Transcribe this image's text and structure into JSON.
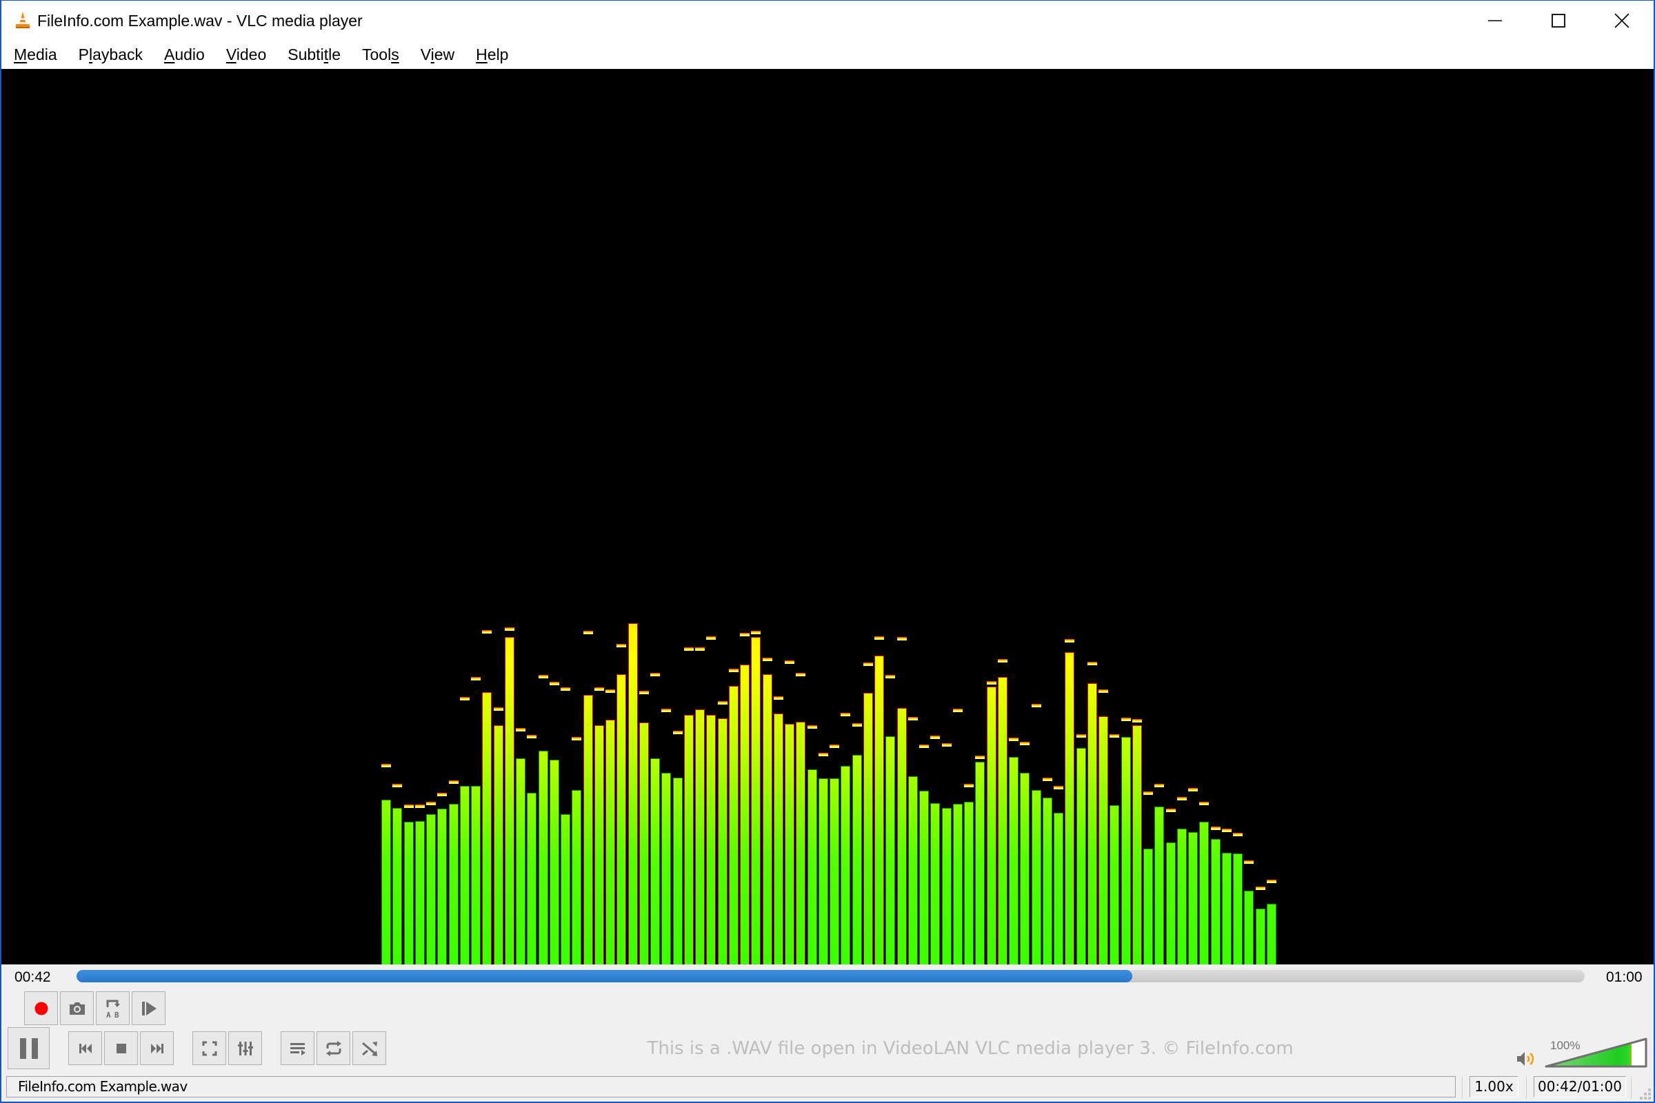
{
  "window": {
    "title": "FileInfo.com Example.wav - VLC media player",
    "controls": [
      "minimize",
      "maximize",
      "close"
    ]
  },
  "menu": [
    {
      "label": "Media",
      "accel_index": 0
    },
    {
      "label": "Playback",
      "accel_index": 1
    },
    {
      "label": "Audio",
      "accel_index": 0
    },
    {
      "label": "Video",
      "accel_index": 0
    },
    {
      "label": "Subtitle",
      "accel_index": 5
    },
    {
      "label": "Tools",
      "accel_index": 4
    },
    {
      "label": "View",
      "accel_index": 1
    },
    {
      "label": "Help",
      "accel_index": 0
    }
  ],
  "visualization": {
    "type": "spectrum-analyzer",
    "bar_count": 80,
    "levels_percent": [
      18.4,
      17.5,
      15.9,
      16.0,
      16.8,
      17.4,
      17.9,
      19.9,
      19.9,
      30.4,
      26.7,
      36.6,
      23.0,
      19.2,
      23.9,
      22.9,
      16.8,
      19.5,
      30.1,
      26.7,
      27.3,
      32.4,
      38.1,
      27.0,
      23.0,
      21.4,
      20.9,
      27.9,
      28.5,
      27.9,
      27.5,
      31.1,
      33.5,
      36.6,
      32.4,
      28.0,
      26.9,
      27.1,
      21.8,
      20.8,
      20.8,
      22.2,
      23.4,
      30.3,
      34.5,
      25.5,
      28.6,
      21.0,
      19.4,
      18.0,
      17.5,
      17.9,
      18.2,
      22.6,
      31.0,
      32.1,
      23.2,
      21.4,
      19.5,
      18.6,
      16.9,
      34.9,
      24.2,
      31.4,
      27.7,
      17.8,
      25.4,
      26.7,
      12.9,
      17.6,
      13.6,
      15.2,
      14.8,
      15.9,
      14.0,
      12.5,
      12.4,
      8.2,
      6.2,
      6.8
    ],
    "peaks_percent": [
      22.2,
      19.9,
      17.6,
      17.6,
      17.9,
      18.9,
      20.3,
      29.6,
      31.9,
      37.1,
      28.5,
      37.4,
      26.2,
      25.4,
      32.1,
      31.3,
      30.7,
      25.2,
      37.0,
      30.7,
      30.5,
      35.6,
      38.1,
      30.3,
      32.3,
      28.3,
      25.9,
      35.2,
      35.2,
      36.4,
      29.2,
      32.8,
      36.8,
      37.0,
      34.0,
      29.7,
      33.7,
      32.3,
      26.5,
      23.4,
      24.3,
      27.9,
      26.7,
      33.5,
      36.4,
      32.1,
      36.3,
      27.4,
      24.3,
      25.3,
      24.5,
      28.3,
      19.9,
      23.1,
      31.4,
      33.9,
      25.1,
      24.6,
      28.9,
      20.6,
      19.7,
      36.1,
      25.5,
      33.6,
      30.5,
      25.5,
      27.3,
      27.2,
      19.1,
      19.9,
      17.2,
      18.5,
      19.5,
      17.9,
      15.2,
      14.9,
      14.5,
      11.4,
      8.5,
      9.2
    ],
    "colors": {
      "low": "#3cff00",
      "high": "#ffff00",
      "peak_edge": "#e01000"
    }
  },
  "seek": {
    "elapsed": "00:42",
    "total": "01:00",
    "progress": 0.7
  },
  "controls": {
    "advanced": [
      "record",
      "snapshot",
      "loop-a-b",
      "frame-by-frame"
    ],
    "main": [
      "pause",
      "previous",
      "stop",
      "next",
      "fullscreen",
      "extended-settings",
      "playlist",
      "loop",
      "random"
    ],
    "record_color": "#ff0000",
    "icon_color": "#6e6e6e"
  },
  "watermark": "This is a .WAV file open in VideoLAN VLC media player 3. © FileInfo.com",
  "volume": {
    "label": "100%",
    "level": 1.0,
    "icon": "speaker-icon",
    "accent": "#ff9800",
    "fill": "#22cc22"
  },
  "status": {
    "filename": "FileInfo.com Example.wav",
    "rate": "1.00x",
    "time": "00:42/01:00"
  }
}
